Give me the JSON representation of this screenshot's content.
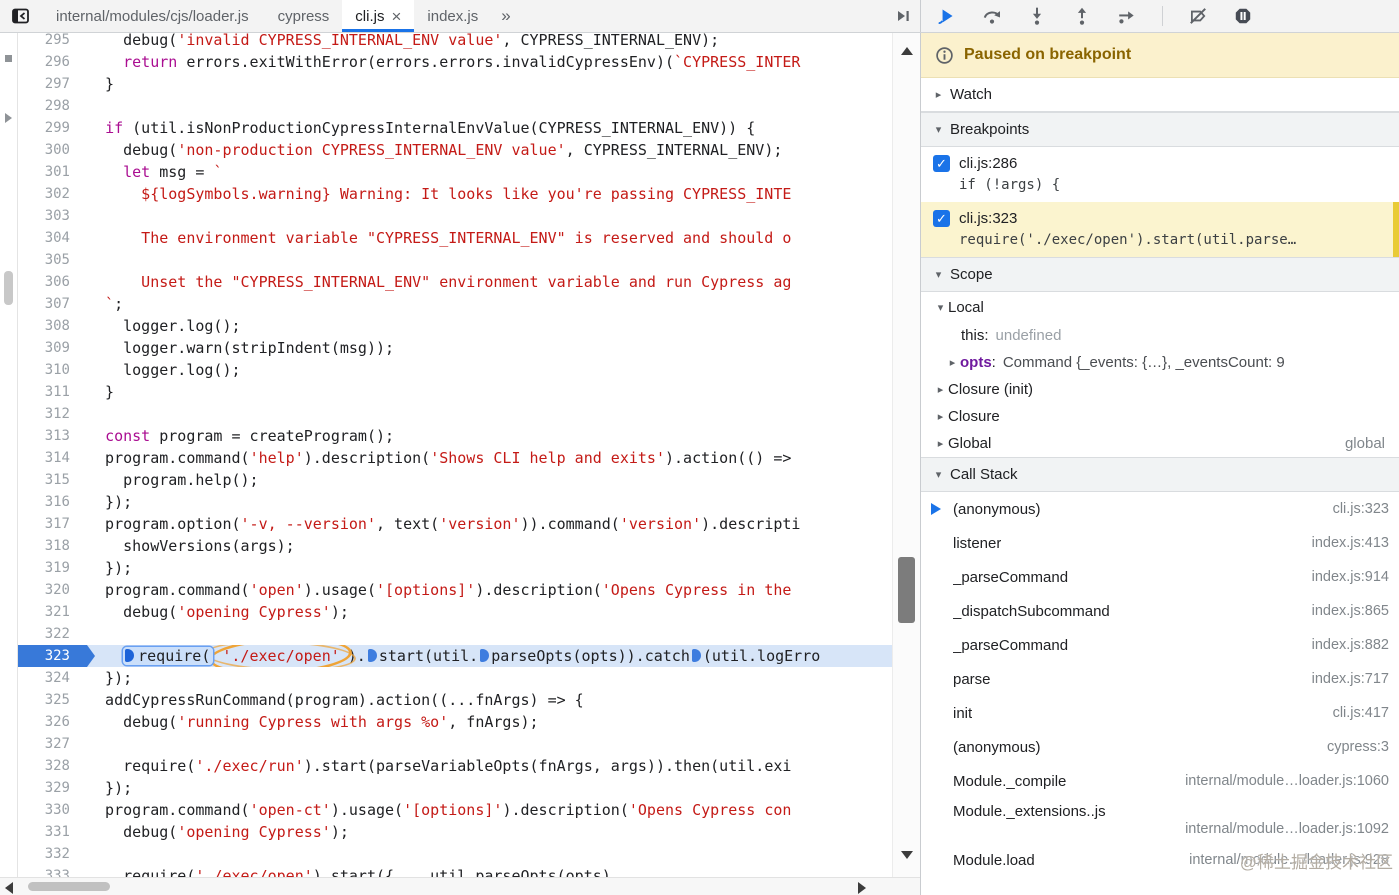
{
  "colors": {
    "accent_blue": "#1a73e8",
    "current_line_gutter": "#3879d9",
    "current_line_bg": "#d7e5f8",
    "paused_banner_bg": "#fbf1cd",
    "paused_text": "#8a6400",
    "keyword": "#aa0d91",
    "string": "#c41a16",
    "active_breakpoint_bg": "#fbf4cf",
    "annotation_circle": "#efa437"
  },
  "tabbar": {
    "path_tab": "internal/modules/cjs/loader.js",
    "tabs": [
      {
        "label": "cypress",
        "active": false
      },
      {
        "label": "cli.js",
        "active": true,
        "close": "×"
      },
      {
        "label": "index.js",
        "active": false
      }
    ],
    "more": "»"
  },
  "debug_toolbar": {
    "icons": [
      "resume-icon",
      "step-over-icon",
      "step-into-icon",
      "step-out-icon",
      "step-icon",
      "separator",
      "deactivate-breakpoints-icon",
      "pause-on-exceptions-icon"
    ]
  },
  "editor": {
    "current_line": 323,
    "lines": [
      {
        "n": 295,
        "t": [
          [
            "p",
            "    debug("
          ],
          [
            "s",
            "'invalid CYPRESS_INTERNAL_ENV value'"
          ],
          [
            "p",
            ", CYPRESS_INTERNAL_ENV);"
          ]
        ]
      },
      {
        "n": 296,
        "t": [
          [
            "p",
            "    "
          ],
          [
            "k",
            "return"
          ],
          [
            "p",
            " errors.exitWithError(errors.errors.invalidCypressEnv)("
          ],
          [
            "s",
            "`CYPRESS_INTER"
          ]
        ]
      },
      {
        "n": 297,
        "t": [
          [
            "p",
            "  }"
          ]
        ]
      },
      {
        "n": 298,
        "t": []
      },
      {
        "n": 299,
        "t": [
          [
            "p",
            "  "
          ],
          [
            "k",
            "if"
          ],
          [
            "p",
            " (util.isNonProductionCypressInternalEnvValue(CYPRESS_INTERNAL_ENV)) {"
          ]
        ]
      },
      {
        "n": 300,
        "t": [
          [
            "p",
            "    debug("
          ],
          [
            "s",
            "'non-production CYPRESS_INTERNAL_ENV value'"
          ],
          [
            "p",
            ", CYPRESS_INTERNAL_ENV);"
          ]
        ]
      },
      {
        "n": 301,
        "t": [
          [
            "p",
            "    "
          ],
          [
            "k",
            "let"
          ],
          [
            "p",
            " msg = "
          ],
          [
            "s",
            "`"
          ]
        ]
      },
      {
        "n": 302,
        "t": [
          [
            "s",
            "      ${logSymbols.warning} Warning: It looks like you're passing CYPRESS_INTE"
          ]
        ]
      },
      {
        "n": 303,
        "t": []
      },
      {
        "n": 304,
        "t": [
          [
            "s",
            "      The environment variable \"CYPRESS_INTERNAL_ENV\" is reserved and should o"
          ]
        ]
      },
      {
        "n": 305,
        "t": []
      },
      {
        "n": 306,
        "t": [
          [
            "s",
            "      Unset the \"CYPRESS_INTERNAL_ENV\" environment variable and run Cypress ag"
          ]
        ]
      },
      {
        "n": 307,
        "t": [
          [
            "s",
            "  `"
          ],
          [
            "p",
            ";"
          ]
        ]
      },
      {
        "n": 308,
        "t": [
          [
            "p",
            "    logger.log();"
          ]
        ]
      },
      {
        "n": 309,
        "t": [
          [
            "p",
            "    logger.warn(stripIndent(msg));"
          ]
        ]
      },
      {
        "n": 310,
        "t": [
          [
            "p",
            "    logger.log();"
          ]
        ]
      },
      {
        "n": 311,
        "t": [
          [
            "p",
            "  }"
          ]
        ]
      },
      {
        "n": 312,
        "t": []
      },
      {
        "n": 313,
        "t": [
          [
            "p",
            "  "
          ],
          [
            "k",
            "const"
          ],
          [
            "p",
            " program = createProgram();"
          ]
        ]
      },
      {
        "n": 314,
        "t": [
          [
            "p",
            "  program.command("
          ],
          [
            "s",
            "'help'"
          ],
          [
            "p",
            ").description("
          ],
          [
            "s",
            "'Shows CLI help and exits'"
          ],
          [
            "p",
            ").action(() =>"
          ]
        ]
      },
      {
        "n": 315,
        "t": [
          [
            "p",
            "    program.help();"
          ]
        ]
      },
      {
        "n": 316,
        "t": [
          [
            "p",
            "  });"
          ]
        ]
      },
      {
        "n": 317,
        "t": [
          [
            "p",
            "  program.option("
          ],
          [
            "s",
            "'-v, --version'"
          ],
          [
            "p",
            ", text("
          ],
          [
            "s",
            "'version'"
          ],
          [
            "p",
            ")).command("
          ],
          [
            "s",
            "'version'"
          ],
          [
            "p",
            ").descripti"
          ]
        ]
      },
      {
        "n": 318,
        "t": [
          [
            "p",
            "    showVersions(args);"
          ]
        ]
      },
      {
        "n": 319,
        "t": [
          [
            "p",
            "  });"
          ]
        ]
      },
      {
        "n": 320,
        "t": [
          [
            "p",
            "  program.command("
          ],
          [
            "s",
            "'open'"
          ],
          [
            "p",
            ").usage("
          ],
          [
            "s",
            "'[options]'"
          ],
          [
            "p",
            ").description("
          ],
          [
            "s",
            "'Opens Cypress in the"
          ]
        ]
      },
      {
        "n": 321,
        "t": [
          [
            "p",
            "    debug("
          ],
          [
            "s",
            "'opening Cypress'"
          ],
          [
            "p",
            ");"
          ]
        ]
      },
      {
        "n": 322,
        "t": []
      },
      {
        "n": 323,
        "t": [
          [
            "p",
            "    "
          ],
          [
            "bx",
            "require("
          ],
          [
            "c",
            "'./exec/open'"
          ],
          [
            "p",
            ")."
          ],
          [
            "m",
            ""
          ],
          [
            "p",
            "start(util."
          ],
          [
            "m",
            ""
          ],
          [
            "p",
            "parseOpts(opts)).catch"
          ],
          [
            "m",
            ""
          ],
          [
            "p",
            "(util.logErro"
          ]
        ]
      },
      {
        "n": 324,
        "t": [
          [
            "p",
            "  });"
          ]
        ]
      },
      {
        "n": 325,
        "t": [
          [
            "p",
            "  addCypressRunCommand(program).action((...fnArgs) => {"
          ]
        ]
      },
      {
        "n": 326,
        "t": [
          [
            "p",
            "    debug("
          ],
          [
            "s",
            "'running Cypress with args %o'"
          ],
          [
            "p",
            ", fnArgs);"
          ]
        ]
      },
      {
        "n": 327,
        "t": []
      },
      {
        "n": 328,
        "t": [
          [
            "p",
            "    require("
          ],
          [
            "s",
            "'./exec/run'"
          ],
          [
            "p",
            ").start(parseVariableOpts(fnArgs, args)).then(util.exi"
          ]
        ]
      },
      {
        "n": 329,
        "t": [
          [
            "p",
            "  });"
          ]
        ]
      },
      {
        "n": 330,
        "t": [
          [
            "p",
            "  program.command("
          ],
          [
            "s",
            "'open-ct'"
          ],
          [
            "p",
            ").usage("
          ],
          [
            "s",
            "'[options]'"
          ],
          [
            "p",
            ").description("
          ],
          [
            "s",
            "'Opens Cypress con"
          ]
        ]
      },
      {
        "n": 331,
        "t": [
          [
            "p",
            "    debug("
          ],
          [
            "s",
            "'opening Cypress'"
          ],
          [
            "p",
            ");"
          ]
        ]
      },
      {
        "n": 332,
        "t": []
      },
      {
        "n": 333,
        "t": [
          [
            "p",
            "    require("
          ],
          [
            "s",
            "'./exec/open'"
          ],
          [
            "p",
            ").start({ ...util.parseOpts(opts)"
          ]
        ]
      }
    ]
  },
  "sidebar": {
    "paused": {
      "text": "Paused on breakpoint"
    },
    "watch": {
      "label": "Watch"
    },
    "breakpoints": {
      "label": "Breakpoints",
      "items": [
        {
          "location": "cli.js:286",
          "preview": "if (!args) {",
          "checked": true,
          "active": false
        },
        {
          "location": "cli.js:323",
          "preview": "require('./exec/open').start(util.parse…",
          "checked": true,
          "active": true
        }
      ]
    },
    "scope": {
      "label": "Scope",
      "rows": [
        {
          "type": "group-open",
          "label": "Local"
        },
        {
          "type": "var",
          "name": "this",
          "value": "undefined",
          "gray": true
        },
        {
          "type": "var-exp",
          "name": "opts",
          "value": "Command {_events: {…}, _eventsCount: 9"
        },
        {
          "type": "group",
          "label": "Closure (init)"
        },
        {
          "type": "group",
          "label": "Closure"
        },
        {
          "type": "group",
          "label": "Global",
          "right": "global"
        }
      ]
    },
    "callstack": {
      "label": "Call Stack",
      "frames": [
        {
          "fn": "(anonymous)",
          "loc": "cli.js:323",
          "current": true
        },
        {
          "fn": "listener",
          "loc": "index.js:413"
        },
        {
          "fn": "_parseCommand",
          "loc": "index.js:914"
        },
        {
          "fn": "_dispatchSubcommand",
          "loc": "index.js:865"
        },
        {
          "fn": "_parseCommand",
          "loc": "index.js:882"
        },
        {
          "fn": "parse",
          "loc": "index.js:717"
        },
        {
          "fn": "init",
          "loc": "cli.js:417"
        },
        {
          "fn": "(anonymous)",
          "loc": "cypress:3"
        },
        {
          "fn": "Module._compile",
          "loc": "internal/module…loader.js:1060"
        },
        {
          "fn": "Module._extensions..js",
          "loc": "internal/module…loader.js:1092",
          "wrap": true
        },
        {
          "fn": "Module.load",
          "loc": "internal/module…/loader.js:928"
        }
      ]
    }
  },
  "watermark": "@稀土掘金技术社区"
}
